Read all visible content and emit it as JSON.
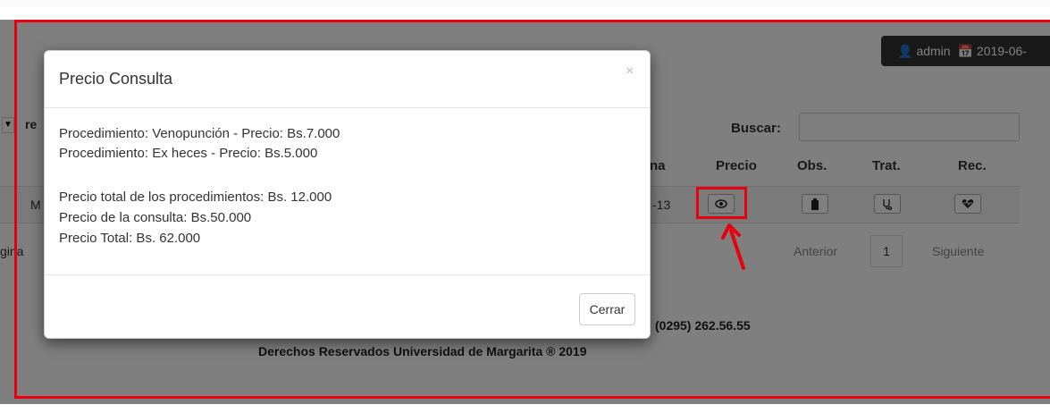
{
  "header": {
    "user_icon": "user-icon",
    "username": "admin",
    "calendar_icon": "calendar-icon",
    "date": "2019-06-"
  },
  "table_controls": {
    "length_select": "▼",
    "length_label": "re",
    "search_label": "Buscar:",
    "search_value": ""
  },
  "table": {
    "columns": [
      "na",
      "Precio",
      "Obs.",
      "Trat.",
      "Rec."
    ],
    "row": {
      "first_cell": "M",
      "date_cell": "-13",
      "precio_icon": "eye-icon",
      "obs_icon": "clipboard-icon",
      "trat_icon": "stethoscope-icon",
      "rec_icon": "heartbeat-icon"
    }
  },
  "table_info": "gina",
  "pagination": {
    "prev": "Anterior",
    "current": "1",
    "next": "Siguiente"
  },
  "footer": {
    "phone": "(0295) 262.56.55",
    "copyright": "Derechos Reservados Universidad de Margarita ® 2019"
  },
  "modal": {
    "title": "Precio Consulta",
    "close": "×",
    "lines": [
      "Procedimiento: Venopunción - Precio: Bs.7.000",
      "Procedimiento: Ex heces - Precio: Bs.5.000",
      "Precio total de los procedimientos: Bs. 12.000",
      "Precio de la consulta: Bs.50.000",
      "Precio Total: Bs. 62.000"
    ],
    "close_button": "Cerrar"
  },
  "colors": {
    "annotation": "#e8000f",
    "overlay": "rgba(0,0,0,0.5)",
    "userbox": "#333333"
  }
}
